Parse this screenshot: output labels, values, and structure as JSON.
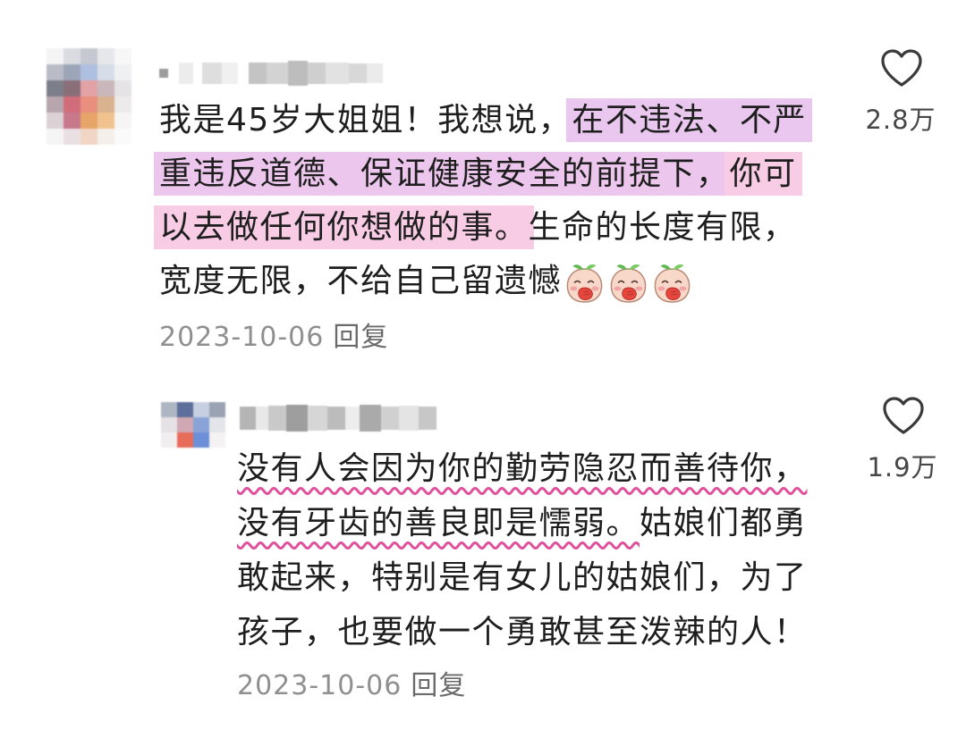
{
  "colors": {
    "body_text": "#1e1e1e",
    "meta_text": "#8f8f8f",
    "reply_text": "#6a6a6a",
    "like_count_text": "#474747",
    "highlight_lavender": "#e9c7ef",
    "highlight_pink": "#f8cce5",
    "wavy_underline": "#e0509c"
  },
  "comments": [
    {
      "avatar_icon": "pixelated-avatar-icon",
      "lines": [
        [
          {
            "text": "我是45岁大姐姐！我想说，"
          },
          {
            "text": "在不违法、不严",
            "highlight": "#e9c7ef"
          }
        ],
        [
          {
            "text": "重违反道德、保证健康安全的前提下，",
            "highlight": "#ecc6ec"
          },
          {
            "text": "你可",
            "highlight": "#f8cce5"
          }
        ],
        [
          {
            "text": "以去做任何你想做的事。",
            "highlight": "#f8cce5"
          },
          {
            "text": "生命的长度有限，"
          }
        ],
        [
          {
            "text": "宽度无限，不给自己留遗憾"
          }
        ]
      ],
      "emojis": [
        "shy-peach-emoji-icon",
        "shy-peach-emoji-icon",
        "shy-peach-emoji-icon"
      ],
      "date": "2023-10-06",
      "reply_label": "回复",
      "like_icon": "heart-outline-icon",
      "like_count": "2.8万"
    },
    {
      "avatar_icon": "pixelated-avatar-icon",
      "lines": [
        [
          {
            "text": "没有人会因为你的勤劳隐忍而善待你，",
            "wavy_underline": "#e0509c"
          }
        ],
        [
          {
            "text": "没有牙齿的善良即是懦弱。",
            "wavy_underline": "#e0509c"
          },
          {
            "text": "姑娘们都勇"
          }
        ],
        [
          {
            "text": "敢起来，特别是有女儿的姑娘们，为了"
          }
        ],
        [
          {
            "text": "孩子，也要做一个勇敢甚至泼辣的人！"
          }
        ]
      ],
      "date": "2023-10-06",
      "reply_label": "回复",
      "like_icon": "heart-outline-icon",
      "like_count": "1.9万"
    }
  ]
}
